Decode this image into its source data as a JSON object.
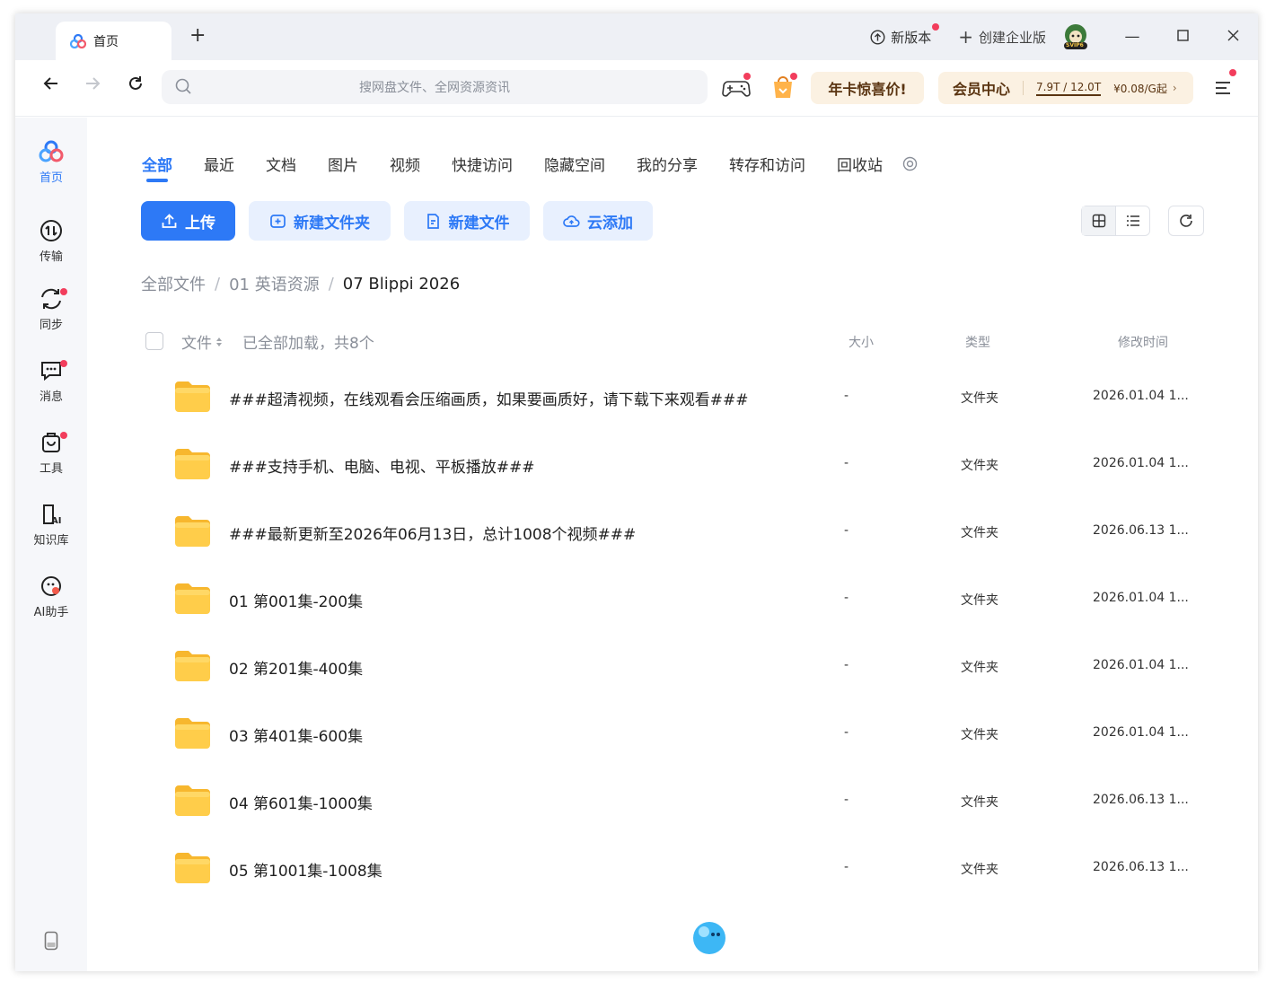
{
  "titlebar": {
    "tab_label": "首页",
    "new_tab_symbol": "+",
    "new_version": "新版本",
    "create_enterprise": "创建企业版",
    "avatar_badge": "SVIP6"
  },
  "navbar": {
    "search_placeholder": "搜网盘文件、全网资源资讯",
    "promo_label": "年卡惊喜价!",
    "vip_title": "会员中心",
    "vip_storage": "7.9T / 12.0T",
    "vip_price": "¥0.08/G起"
  },
  "sidebar": {
    "items": [
      {
        "label": "首页",
        "icon": "home-logo-icon"
      },
      {
        "label": "传输",
        "icon": "transfer-icon"
      },
      {
        "label": "同步",
        "icon": "sync-icon"
      },
      {
        "label": "消息",
        "icon": "message-icon"
      },
      {
        "label": "工具",
        "icon": "toolbox-icon"
      },
      {
        "label": "知识库",
        "icon": "knowledge-base-icon"
      },
      {
        "label": "AI助手",
        "icon": "ai-assistant-icon"
      }
    ]
  },
  "categories": [
    "全部",
    "最近",
    "文档",
    "图片",
    "视频",
    "快捷访问",
    "隐藏空间",
    "我的分享",
    "转存和访问",
    "回收站"
  ],
  "actions": {
    "upload": "上传",
    "new_folder": "新建文件夹",
    "new_file": "新建文件",
    "cloud_add": "云添加"
  },
  "breadcrumb": {
    "root": "全部文件",
    "parent": "01 英语资源",
    "current": "07 Blippi 2026",
    "separator": "/"
  },
  "list_header": {
    "file": "文件",
    "count_text": "已全部加载，共8个",
    "size": "大小",
    "type": "类型",
    "modified": "修改时间"
  },
  "files": [
    {
      "name": "###超清视频，在线观看会压缩画质，如果要画质好，请下载下来观看###",
      "size": "-",
      "type": "文件夹",
      "modified": "2026.01.04 1..."
    },
    {
      "name": "###支持手机、电脑、电视、平板播放###",
      "size": "-",
      "type": "文件夹",
      "modified": "2026.01.04 1..."
    },
    {
      "name": "###最新更新至2026年06月13日，总计1008个视频###",
      "size": "-",
      "type": "文件夹",
      "modified": "2026.06.13 1..."
    },
    {
      "name": "01 第001集-200集",
      "size": "-",
      "type": "文件夹",
      "modified": "2026.01.04 1..."
    },
    {
      "name": "02 第201集-400集",
      "size": "-",
      "type": "文件夹",
      "modified": "2026.01.04 1..."
    },
    {
      "name": "03 第401集-600集",
      "size": "-",
      "type": "文件夹",
      "modified": "2026.01.04 1..."
    },
    {
      "name": "04 第601集-1000集",
      "size": "-",
      "type": "文件夹",
      "modified": "2026.06.13 1..."
    },
    {
      "name": "05 第1001集-1008集",
      "size": "-",
      "type": "文件夹",
      "modified": "2026.06.13 1..."
    }
  ],
  "colors": {
    "accent": "#2d79f6",
    "notification_dot": "#f23d5c",
    "folder": "#ffc940",
    "vip_bg": "#fbf1e2"
  }
}
